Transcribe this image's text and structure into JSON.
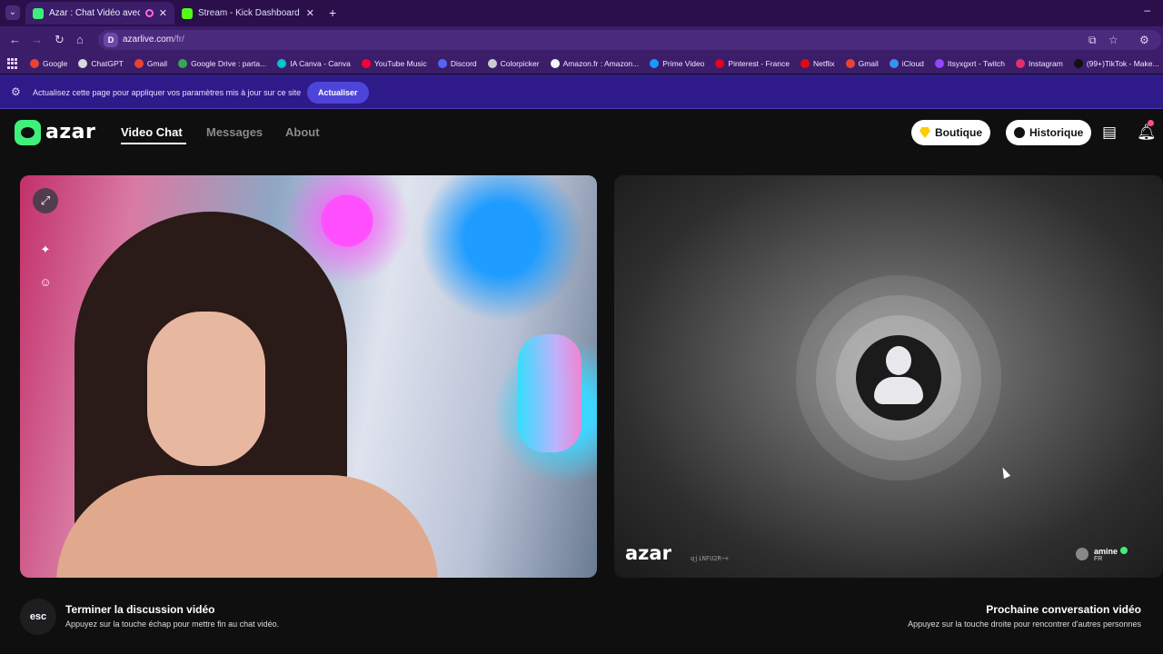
{
  "browser": {
    "tabs": [
      {
        "title": "Azar : Chat Vidéo avec de n",
        "active": true
      },
      {
        "title": "Stream - Kick Dashboard",
        "active": false
      }
    ],
    "new_tab": "+",
    "minimize": "–",
    "url_host": "azarlive.com",
    "url_path": "/fr/",
    "site_icon_letter": "D",
    "bookmarks": [
      {
        "label": "Google",
        "color": "#ea4335"
      },
      {
        "label": "ChatGPT",
        "color": "#d9d9d9"
      },
      {
        "label": "Gmail",
        "color": "#ea4335"
      },
      {
        "label": "Google Drive : parta...",
        "color": "#34a853"
      },
      {
        "label": "IA Canva - Canva",
        "color": "#00c4cc"
      },
      {
        "label": "YouTube Music",
        "color": "#ff0033"
      },
      {
        "label": "Discord",
        "color": "#5865f2"
      },
      {
        "label": "Colorpicker",
        "color": "#cccccc"
      },
      {
        "label": "Amazon.fr : Amazon...",
        "color": "#f5f5f5"
      },
      {
        "label": "Prime Video",
        "color": "#1a98ff"
      },
      {
        "label": "Pinterest - France",
        "color": "#e60023"
      },
      {
        "label": "Netflix",
        "color": "#e50914"
      },
      {
        "label": "Gmail",
        "color": "#ea4335"
      },
      {
        "label": "iCloud",
        "color": "#3693f5"
      },
      {
        "label": "Itsyxgxrt - Twitch",
        "color": "#9146ff"
      },
      {
        "label": "Instagram",
        "color": "#e1306c"
      },
      {
        "label": "(99+)TikTok - Make...",
        "color": "#111111"
      }
    ],
    "infobar": {
      "text": "Actualisez cette page pour appliquer vos paramètres mis à jour sur ce site",
      "button": "Actualiser"
    }
  },
  "app": {
    "logo": "azar",
    "nav": [
      {
        "label": "Video Chat",
        "active": true
      },
      {
        "label": "Messages",
        "active": false
      },
      {
        "label": "About",
        "active": false
      }
    ],
    "boutique_label": "Boutique",
    "historique_label": "Historique",
    "notification_count": "1",
    "remote": {
      "watermark": "azar",
      "watermark_id": "qjiNFU2R~+",
      "user_name": "amine",
      "user_country": "FR"
    },
    "hints": {
      "end_key": "esc",
      "end_title": "Terminer la discussion vidéo",
      "end_sub": "Appuyez sur la touche échap pour mettre fin au chat vidéo.",
      "next_title": "Prochaine conversation vidéo",
      "next_sub": "Appuyez sur la touche droite pour rencontrer d'autres personnes"
    },
    "colors": {
      "brand": "#3ff07a",
      "background": "#0f0f10"
    }
  }
}
